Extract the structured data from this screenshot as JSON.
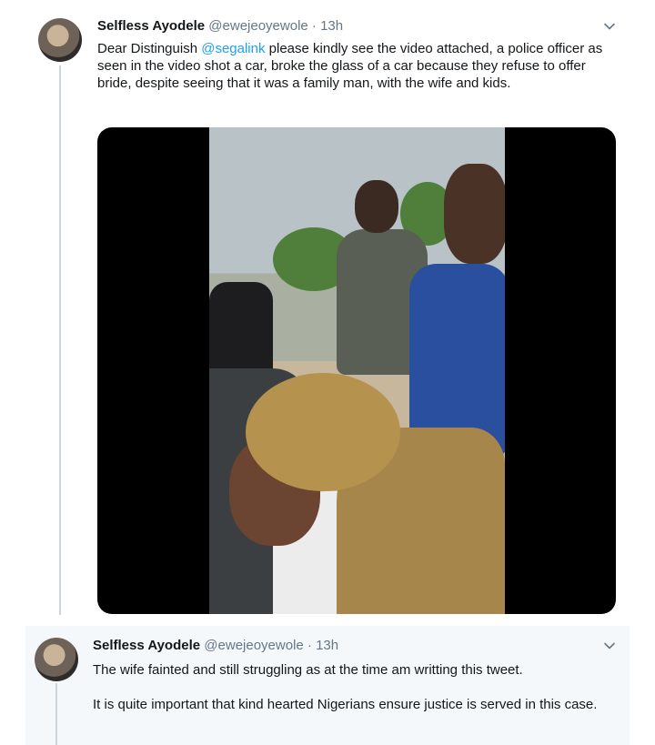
{
  "tweets": [
    {
      "author_name": "Selfless Ayodele",
      "author_handle": "@ewejeoyewole",
      "separator": "·",
      "time": "13h",
      "text_before_mention": "Dear Distinguish ",
      "mention": "@segalink",
      "text_after_mention": " please kindly see the video attached, a police officer as seen in the video shot a car, broke the glass of a car because they refuse to offer bride, despite seeing that it was a family man, with the wife and kids."
    },
    {
      "author_name": "Selfless Ayodele",
      "author_handle": "@ewejeoyewole",
      "separator": "·",
      "time": "13h",
      "paragraph1": "The wife fainted and still struggling as at the time am writting this tweet.",
      "paragraph2": "It is quite important that kind hearted Nigerians ensure justice is served in this case."
    }
  ],
  "icons": {
    "caret": "chevron-down-icon",
    "avatar": "avatar"
  },
  "colors": {
    "mention": "#1da1f2",
    "secondary_text": "#657786",
    "thread_line": "#ccd6dd"
  }
}
